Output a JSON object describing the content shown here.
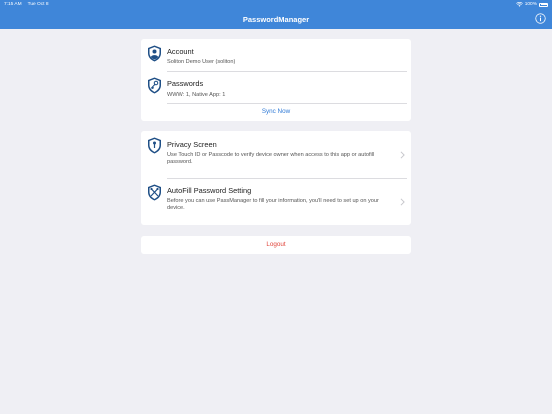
{
  "status_bar": {
    "time": "7:15 AM",
    "date": "Tue Oct 8",
    "battery": "100%",
    "wifi_icon": "wifi-icon",
    "battery_icon": "battery-icon"
  },
  "navbar": {
    "title": "PasswordManager",
    "info_icon": "info-icon"
  },
  "account_card": {
    "account": {
      "title": "Account",
      "subtitle": "Soliton Demo User (soliton)",
      "icon": "user-shield-icon"
    },
    "passwords": {
      "title": "Passwords",
      "subtitle": "WWW: 1, Native App: 1",
      "icon": "key-shield-icon"
    },
    "sync_label": "Sync Now"
  },
  "settings_card": {
    "privacy": {
      "title": "Privacy Screen",
      "subtitle": "Use Touch ID or Passcode to verify device owner when access to this app or autofill password.",
      "icon": "keyhole-shield-icon"
    },
    "autofill": {
      "title": "AutoFill Password Setting",
      "subtitle": "Before you can use PassManager to fill your information, you'll need to set up on your device.",
      "icon": "tools-shield-icon"
    }
  },
  "logout_label": "Logout",
  "colors": {
    "nav": "#3f86d9",
    "link": "#2f7ad6",
    "destructive": "#e0443a",
    "icon": "#1f4f86"
  }
}
